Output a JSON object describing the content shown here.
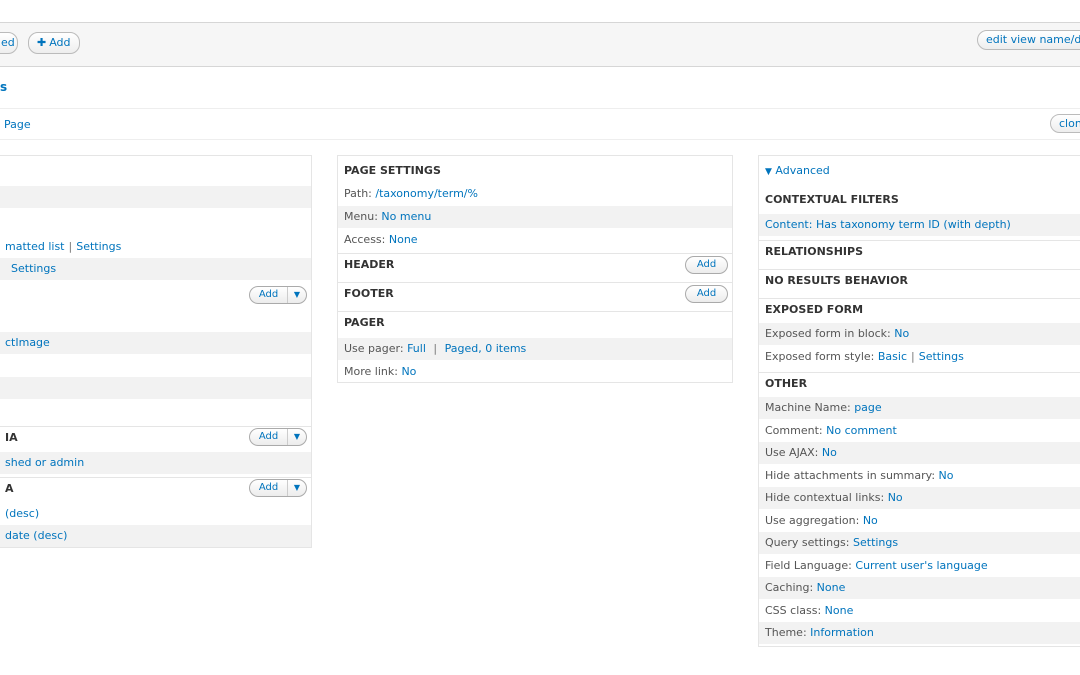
{
  "toolbar": {
    "partial_button": "ed",
    "add_label": "Add",
    "edit_name_button": "edit view name/de"
  },
  "view_title": "s",
  "display": {
    "tab_label": "Page",
    "clone_button": "clon"
  },
  "left_column": {
    "format_links": [
      "matted list",
      "Settings"
    ],
    "show_settings": "Settings",
    "field_add": "Add",
    "field_item": "ctImage",
    "filter_header": "IA",
    "filter_add": "Add",
    "filter_item": "shed or admin",
    "sort_header": "A",
    "sort_add": "Add",
    "sort_items": [
      "(desc)",
      "date (desc)"
    ]
  },
  "middle_column": {
    "page_settings": "PAGE SETTINGS",
    "path_label": "Path:",
    "path_value": "/taxonomy/term/%",
    "menu_label": "Menu:",
    "menu_value": "No menu",
    "access_label": "Access:",
    "access_value": "None",
    "header": "HEADER",
    "header_add": "Add",
    "footer": "FOOTER",
    "footer_add": "Add",
    "pager": "PAGER",
    "use_pager_label": "Use pager:",
    "use_pager_value": "Full",
    "use_pager_sep": "|",
    "use_pager_paged": "Paged, 0 items",
    "more_link_label": "More link:",
    "more_link_value": "No"
  },
  "right_column": {
    "advanced_toggle": "Advanced",
    "contextual_filters": "CONTEXTUAL FILTERS",
    "contextual_item": "Content: Has taxonomy term ID (with depth)",
    "relationships": "RELATIONSHIPS",
    "no_results": "NO RESULTS BEHAVIOR",
    "exposed_form": "EXPOSED FORM",
    "exposed_block_label": "Exposed form in block:",
    "exposed_block_value": "No",
    "exposed_style_label": "Exposed form style:",
    "exposed_style_value": "Basic",
    "exposed_style_settings": "Settings",
    "other": "OTHER",
    "other_rows": [
      {
        "label": "Machine Name:",
        "value": "page"
      },
      {
        "label": "Comment:",
        "value": "No comment"
      },
      {
        "label": "Use AJAX:",
        "value": "No"
      },
      {
        "label": "Hide attachments in summary:",
        "value": "No"
      },
      {
        "label": "Hide contextual links:",
        "value": "No"
      },
      {
        "label": "Use aggregation:",
        "value": "No"
      },
      {
        "label": "Query settings:",
        "value": "Settings"
      },
      {
        "label": "Field Language:",
        "value": "Current user's language"
      },
      {
        "label": "Caching:",
        "value": "None"
      },
      {
        "label": "CSS class:",
        "value": "None"
      },
      {
        "label": "Theme:",
        "value": "Information"
      }
    ]
  },
  "colors": {
    "link": "#0074bd",
    "alt_row": "#f2f2f2"
  },
  "icons": [
    "plus-icon",
    "triangle-down-icon",
    "caret-down-icon"
  ]
}
